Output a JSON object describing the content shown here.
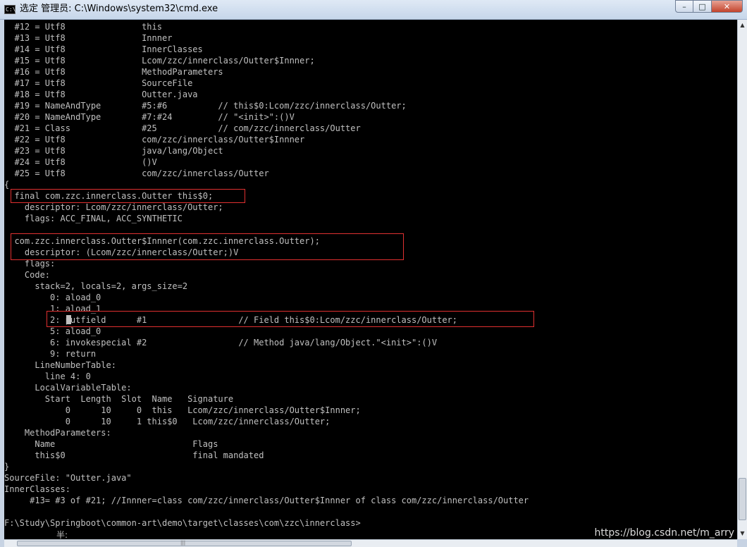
{
  "window": {
    "title": "选定 管理员: C:\\Windows\\system32\\cmd.exe",
    "icon": "cmd-icon",
    "buttons": {
      "minimize": "–",
      "maximize": "□",
      "close": "✕"
    }
  },
  "console": {
    "lines": [
      "  #12 = Utf8               this",
      "  #13 = Utf8               Innner",
      "  #14 = Utf8               InnerClasses",
      "  #15 = Utf8               Lcom/zzc/innerclass/Outter$Innner;",
      "  #16 = Utf8               MethodParameters",
      "  #17 = Utf8               SourceFile",
      "  #18 = Utf8               Outter.java",
      "  #19 = NameAndType        #5:#6          // this$0:Lcom/zzc/innerclass/Outter;",
      "  #20 = NameAndType        #7:#24         // \"<init>\":()V",
      "  #21 = Class              #25            // com/zzc/innerclass/Outter",
      "  #22 = Utf8               com/zzc/innerclass/Outter$Innner",
      "  #23 = Utf8               java/lang/Object",
      "  #24 = Utf8               ()V",
      "  #25 = Utf8               com/zzc/innerclass/Outter",
      "{",
      "  final com.zzc.innerclass.Outter this$0;",
      "    descriptor: Lcom/zzc/innerclass/Outter;",
      "    flags: ACC_FINAL, ACC_SYNTHETIC",
      "",
      "  com.zzc.innerclass.Outter$Innner(com.zzc.innerclass.Outter);",
      "    descriptor: (Lcom/zzc/innerclass/Outter;)V",
      "    flags:",
      "    Code:",
      "      stack=2, locals=2, args_size=2",
      "         0: aload_0",
      "         1: aload_1",
      "         2: putfield      #1                  // Field this$0:Lcom/zzc/innerclass/Outter;",
      "         5: aload_0",
      "         6: invokespecial #2                  // Method java/lang/Object.\"<init>\":()V",
      "         9: return",
      "      LineNumberTable:",
      "        line 4: 0",
      "      LocalVariableTable:",
      "        Start  Length  Slot  Name   Signature",
      "            0      10     0  this   Lcom/zzc/innerclass/Outter$Innner;",
      "            0      10     1 this$0   Lcom/zzc/innerclass/Outter;",
      "    MethodParameters:",
      "      Name                           Flags",
      "      this$0                         final mandated",
      "}",
      "SourceFile: \"Outter.java\"",
      "InnerClasses:",
      "     #13= #3 of #21; //Innner=class com/zzc/innerclass/Outter$Innner of class com/zzc/innerclass/Outter",
      "",
      "F:\\Study\\Springboot\\common-art\\demo\\target\\classes\\com\\zzc\\innerclass>"
    ],
    "ime_text": "半:"
  },
  "watermark": "https://blog.csdn.net/m_arry",
  "highlight_color": "#e03030"
}
